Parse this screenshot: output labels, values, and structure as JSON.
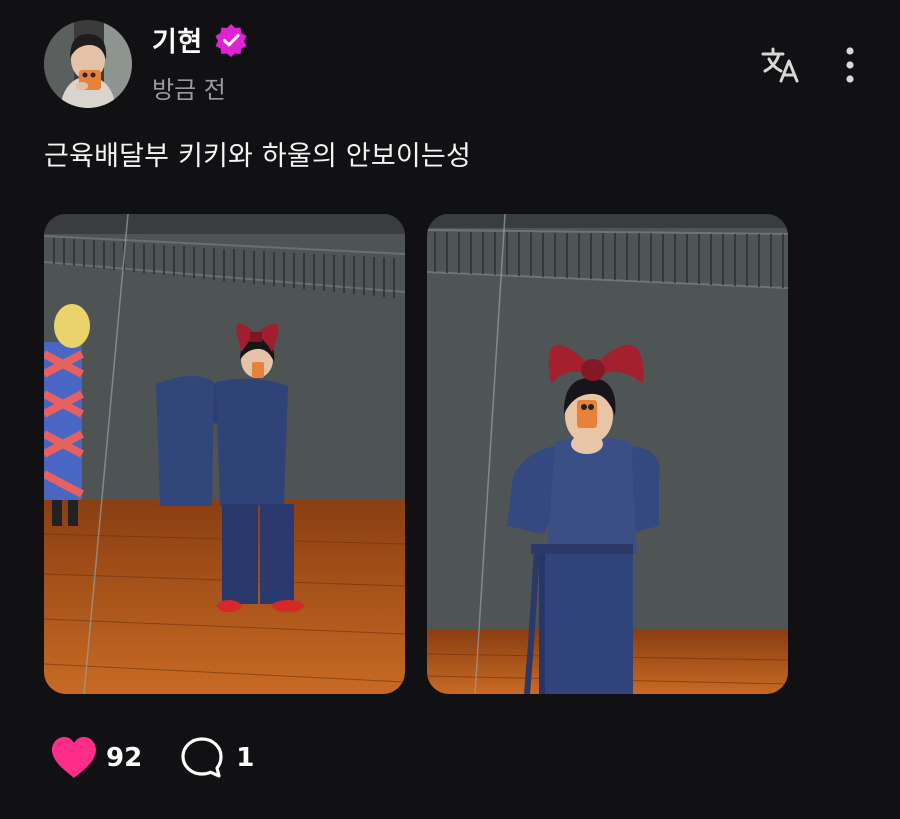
{
  "post": {
    "author": {
      "name": "기현",
      "verified": true,
      "verified_color": "#e022d4"
    },
    "timestamp": "방금 전",
    "caption": "근육배달부 키키와 하울의 안보이는성",
    "photos": [
      {
        "description": "mirror-selfie-wide"
      },
      {
        "description": "mirror-selfie-close"
      }
    ]
  },
  "header_actions": {
    "translate_icon": "translate-icon",
    "more_icon": "more-vertical-icon"
  },
  "engagement": {
    "likes": "92",
    "replies": "1",
    "like_color": "#ff2d8a"
  }
}
